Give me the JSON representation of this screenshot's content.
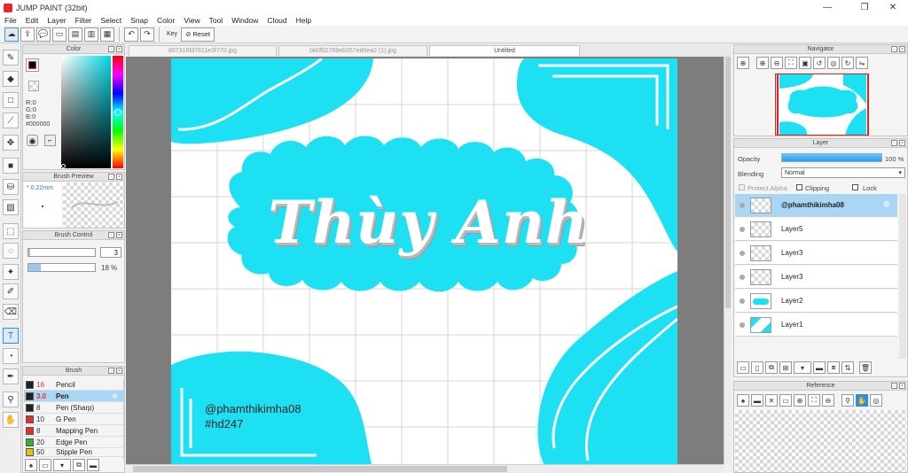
{
  "app": {
    "title": "JUMP PAINT (32bit)",
    "window_controls": [
      "—",
      "❐",
      "✕"
    ]
  },
  "menu": [
    "File",
    "Edit",
    "Layer",
    "Filter",
    "Select",
    "Snap",
    "Color",
    "View",
    "Tool",
    "Window",
    "Cloud",
    "Help"
  ],
  "toolbar": {
    "key_label": "Key",
    "reset_label": "Reset"
  },
  "color_panel": {
    "title": "Color",
    "r": "R:0",
    "g": "G:0",
    "b": "B:0",
    "hex": "#000000",
    "current_color": "#000000"
  },
  "brush_preview": {
    "title": "Brush Preview",
    "size": "* 0.22mm"
  },
  "brush_control": {
    "title": "Brush Control",
    "size_value": "3",
    "opacity_value": "18 %"
  },
  "brush_list": {
    "title": "Brush",
    "items": [
      {
        "size": "16",
        "name": "Pencil",
        "color": "#222222"
      },
      {
        "size": "3.0",
        "name": "Pen",
        "color": "#222222"
      },
      {
        "size": "8",
        "name": "Pen (Sharp)",
        "color": "#222222"
      },
      {
        "size": "10",
        "name": "G Pen",
        "color": "#e03030"
      },
      {
        "size": "8",
        "name": "Mapping Pen",
        "color": "#e03030"
      },
      {
        "size": "20",
        "name": "Edge Pen",
        "color": "#30b030"
      },
      {
        "size": "50",
        "name": "Stipple Pen",
        "color": "#e0c020"
      }
    ]
  },
  "tabs": [
    "807316fd7611e3f770.jpg",
    "bb0f02769eb357ed0ea2 (1).jpg",
    "Untitled"
  ],
  "canvas": {
    "title_text": "Thùy Anh",
    "credit_line1": "@phamthikimha08",
    "credit_line2": "#hd247",
    "accent": "#1de1f2"
  },
  "navigator": {
    "title": "Navigator"
  },
  "layer_panel": {
    "title": "Layer",
    "opacity_label": "Opacity",
    "opacity_value": "100 %",
    "blending_label": "Blending",
    "blending_value": "Normal",
    "protect_alpha": "Protect Alpha",
    "clipping": "Clipping",
    "lock": "Lock",
    "layers": [
      "@phamthikimha08",
      "Layer5",
      "Layer3",
      "Layer3",
      "Layer2",
      "Layer1"
    ]
  },
  "reference": {
    "title": "Reference"
  }
}
